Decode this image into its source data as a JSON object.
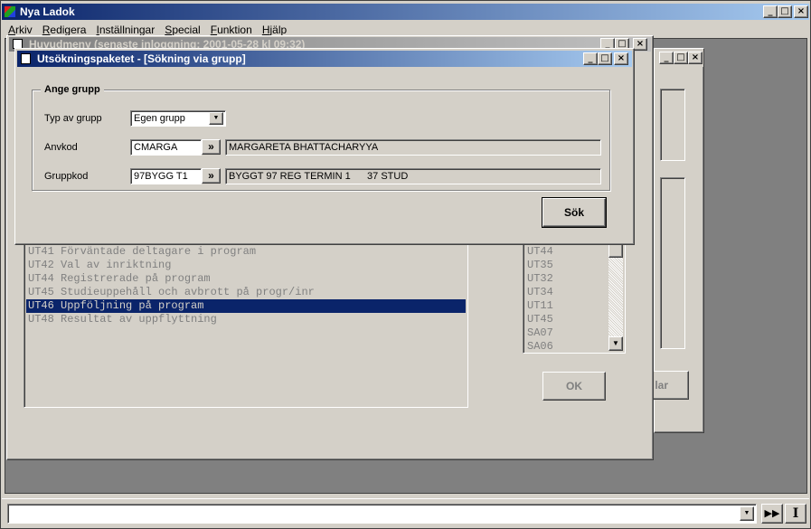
{
  "app": {
    "title": "Nya Ladok",
    "menu": [
      "Arkiv",
      "Redigera",
      "Inställningar",
      "Special",
      "Funktion",
      "Hjälp"
    ]
  },
  "mainmenu_window": {
    "title": "Huvudmeny   (senaste inloggning: 2001-05-28 kl 09:32)"
  },
  "program_list": {
    "items": [
      "UT41 Förväntade deltagare i program",
      "UT42 Val av inriktning",
      "UT44 Registrerade på program",
      "UT45 Studieuppehåll och avbrott på progr/inr",
      "UT46 Uppföljning på program",
      "UT48 Resultat av uppflyttning"
    ],
    "selected_index": 4
  },
  "code_list": {
    "items": [
      "UT44",
      "UT35",
      "UT32",
      "UT34",
      "UT11",
      "UT45",
      "SA07",
      "SA06"
    ]
  },
  "ok_button": {
    "label": "OK"
  },
  "behind_button": {
    "label": "lar"
  },
  "dialog": {
    "title": "Utsökningspaketet - [Sökning via grupp]",
    "group_title": "Ange grupp",
    "typ_label": "Typ av grupp",
    "typ_value": "Egen grupp",
    "anvkod_label": "Anvkod",
    "anvkod_value": "CMARGA",
    "anvkod_name": "MARGARETA BHATTACHARYYA",
    "gruppkod_label": "Gruppkod",
    "gruppkod_value": "97BYGG T1",
    "gruppkod_desc": "BYGGT 97 REG TERMIN 1      37 STUD",
    "lookup_label": "»",
    "search_button": "Sök"
  },
  "colors": {
    "selection": "#0a246a",
    "titlebar_active": "#0a246a",
    "face": "#d4d0c8",
    "desktop": "#808080"
  }
}
